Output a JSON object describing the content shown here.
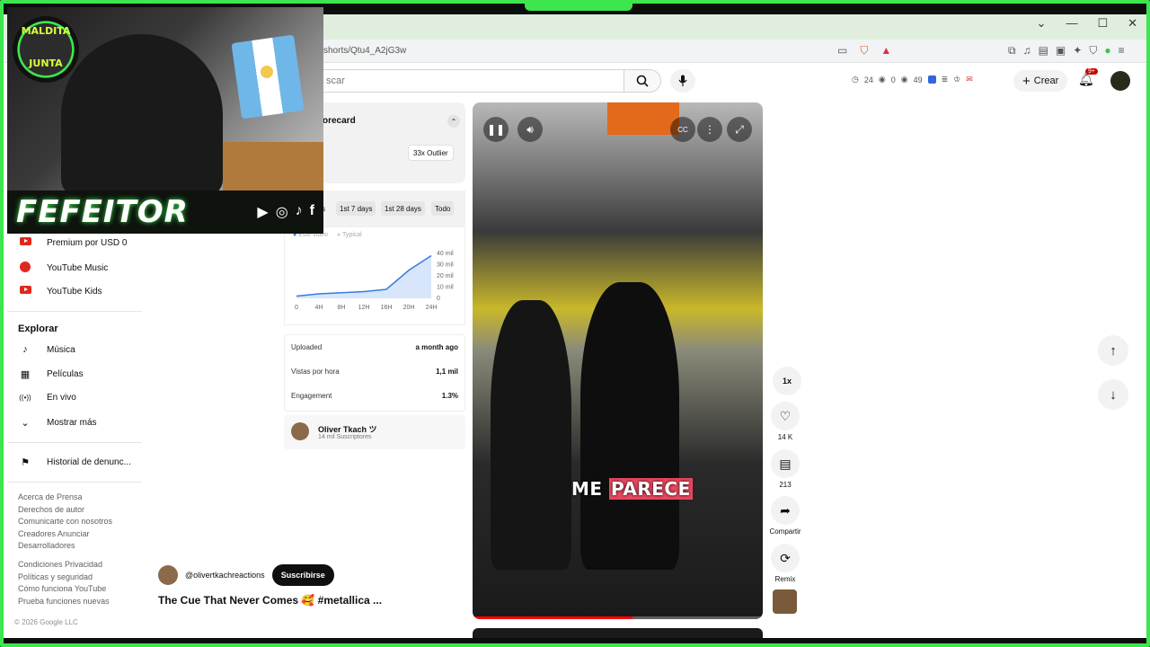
{
  "browser": {
    "url": "shorts/Qtu4_A2jG3w",
    "window_controls": [
      "⌄",
      "—",
      "☐",
      "✕"
    ]
  },
  "header": {
    "search_placeholder": "scar",
    "stats": {
      "clock": "24",
      "eye1": "0",
      "eye2": "49"
    },
    "create_label": "Crear",
    "notif_badge": "9+"
  },
  "overlay": {
    "logo_top": "MALDITA",
    "logo_bottom": "JUNTA",
    "brand_name": "FEFEITOR",
    "socials": [
      "▶",
      "◎",
      "♪",
      "f"
    ]
  },
  "sidebar": {
    "top_items": [
      {
        "label": "Premium por USD 0",
        "icon": "youtube-premium-icon"
      },
      {
        "label": "YouTube Music",
        "icon": "youtube-music-icon"
      },
      {
        "label": "YouTube Kids",
        "icon": "youtube-kids-icon"
      }
    ],
    "explore_title": "Explorar",
    "explore_items": [
      {
        "label": "Música",
        "icon": "music-note-icon",
        "glyph": "♪"
      },
      {
        "label": "Películas",
        "icon": "film-icon",
        "glyph": "▦"
      },
      {
        "label": "En vivo",
        "icon": "live-icon",
        "glyph": "((•))"
      },
      {
        "label": "Mostrar más",
        "icon": "chevron-down-icon",
        "glyph": "⌄"
      }
    ],
    "report_history": {
      "label": "Historial de denunc...",
      "icon": "flag-icon",
      "glyph": "⚑"
    },
    "footer_line1": "Acerca de  Prensa",
    "footer_line2": "Derechos de autor",
    "footer_line3": "Comunicarte con nosotros",
    "footer_line4": "Creadores  Anunciar",
    "footer_line5": "Desarrolladores",
    "footer_line6": "Condiciones  Privacidad",
    "footer_line7": "Políticas y seguridad",
    "footer_line8": "Cómo funciona YouTube",
    "footer_line9": "Prueba funciones nuevas",
    "copyright": "© 2026 Google LLC"
  },
  "scorecard": {
    "title": "orecard",
    "outlier": "33x Outlier",
    "filters": [
      "s",
      "1st 7 days",
      "1st 28 days",
      "Todo"
    ],
    "legend": [
      "Este video",
      "Typical"
    ],
    "rows": [
      {
        "label": "Uploaded",
        "value": "a month ago"
      },
      {
        "label": "Vistas por hora",
        "value": "1,1 mil"
      },
      {
        "label": "Engagement",
        "value": "1.3%"
      }
    ],
    "channel_name": "Oliver Tkach ツ",
    "channel_subs": "14 mil Suscriptores"
  },
  "chart_data": {
    "type": "line",
    "x": [
      "0",
      "4H",
      "8H",
      "12H",
      "16H",
      "20H",
      "24H"
    ],
    "series": [
      {
        "name": "Este video",
        "values": [
          2,
          4,
          5,
          6,
          8,
          25,
          38
        ]
      }
    ],
    "y_ticks": [
      "40 mil",
      "30 mil",
      "20 mil",
      "10 mil",
      "0"
    ],
    "ylim": [
      0,
      40
    ],
    "grid": false,
    "colors": {
      "line": "#3a7ae0",
      "area": "#d7e6fb"
    }
  },
  "video": {
    "caption_a": "ME",
    "caption_b": "PARECE",
    "progress": 0.55,
    "channel_handle": "@olivertkachreactions",
    "subscribe_label": "Suscribirse",
    "title": "The Cue That Never Comes 🥰 #metallica ..."
  },
  "actions": {
    "speed": "1x",
    "likes": "14 K",
    "comments": "213",
    "share": "Compartir",
    "remix": "Remix"
  }
}
